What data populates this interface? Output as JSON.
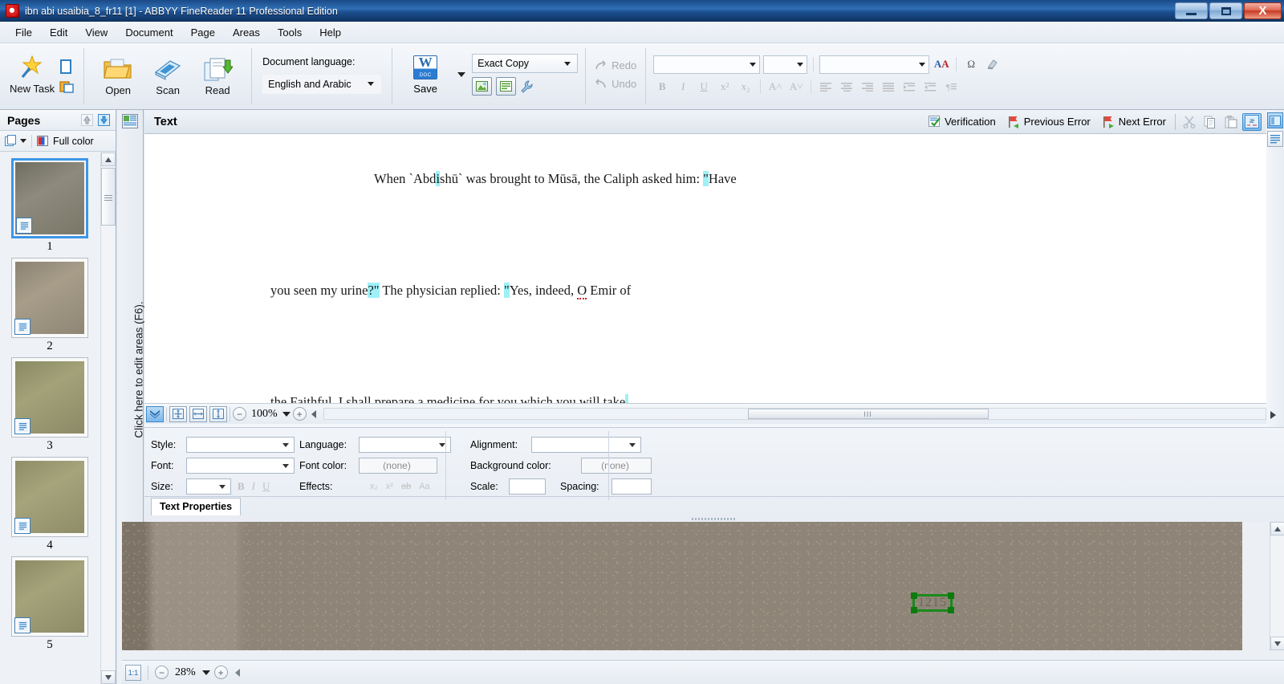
{
  "window": {
    "title": "ibn abi usaibia_8_fr11 [1] - ABBYY FineReader 11 Professional Edition",
    "minimize_label": "Minimize",
    "maximize_label": "Restore",
    "close_label": "X"
  },
  "menu": {
    "items": [
      "File",
      "Edit",
      "View",
      "Document",
      "Page",
      "Areas",
      "Tools",
      "Help"
    ]
  },
  "toolbar": {
    "new_task": "New Task",
    "open": "Open",
    "scan": "Scan",
    "read": "Read",
    "document_language_label": "Document language:",
    "document_language_value": "English and Arabic",
    "save": "Save",
    "save_mode_value": "Exact Copy",
    "redo": "Redo",
    "undo": "Undo",
    "font_name_value": "",
    "font_size_value": "",
    "style_value": "",
    "format_buttons": [
      "B",
      "I",
      "U",
      "x²",
      "x₂",
      "A˄",
      "A˅"
    ],
    "align_buttons": [
      "align-left",
      "align-center",
      "align-right",
      "align-justify",
      "indent",
      "outdent",
      "paragraph"
    ]
  },
  "pages_panel": {
    "title": "Pages",
    "color_mode": "Full color",
    "thumbnails": [
      {
        "number": "1",
        "selected": true
      },
      {
        "number": "2",
        "selected": false
      },
      {
        "number": "3",
        "selected": false
      },
      {
        "number": "4",
        "selected": false
      },
      {
        "number": "5",
        "selected": false
      }
    ]
  },
  "areas_strip": {
    "hint": "Click here to edit areas (F6)."
  },
  "text_panel": {
    "title": "Text",
    "verification": "Verification",
    "previous_error": "Previous Error",
    "next_error": "Next Error",
    "cut": "Cut",
    "copy": "Copy",
    "paste": "Paste",
    "nonprinting": "æ",
    "pilcrow": "¶",
    "lines": [
      {
        "indent": 286,
        "segments": [
          {
            "text": "When `Abd",
            "style": "plain"
          },
          {
            "text": "i",
            "style": "highlight"
          },
          {
            "text": "shū` was brought to Mūsā, the Caliph asked him: ",
            "style": "plain"
          },
          {
            "text": "\"",
            "style": "highlight"
          },
          {
            "text": "Have",
            "style": "plain"
          }
        ]
      },
      {
        "indent": 157,
        "segments": [
          {
            "text": "you seen my urine",
            "style": "plain"
          },
          {
            "text": "?\"",
            "style": "highlight"
          },
          {
            "text": " The physician replied: ",
            "style": "plain"
          },
          {
            "text": "\"",
            "style": "highlight"
          },
          {
            "text": "Yes, indeed, ",
            "style": "plain"
          },
          {
            "text": "O",
            "style": "spell"
          },
          {
            "text": " Emir of",
            "style": "plain"
          }
        ]
      },
      {
        "indent": 157,
        "segments": [
          {
            "text": "the Faithful. I shall prepare a medicine for you which you will take",
            "style": "plain"
          },
          {
            "text": ",",
            "style": "highlight"
          }
        ]
      }
    ]
  },
  "text_zoom_bar": {
    "zoom_value": "100%",
    "fit_buttons": [
      "fit-page",
      "fit-width",
      "fit-height"
    ],
    "zoom_out": "−",
    "zoom_in": "+",
    "scroll_grip": "III"
  },
  "text_properties": {
    "tab_label": "Text Properties",
    "style_label": "Style:",
    "style_value": "",
    "font_label": "Font:",
    "font_value": "",
    "size_label": "Size:",
    "size_value": "",
    "language_label": "Language:",
    "language_value": "",
    "font_color_label": "Font color:",
    "font_color_value": "(none)",
    "effects_label": "Effects:",
    "alignment_label": "Alignment:",
    "alignment_value": "",
    "background_color_label": "Background color:",
    "background_color_value": "(none)",
    "scale_label": "Scale:",
    "scale_value": "",
    "spacing_label": "Spacing:",
    "spacing_value": "",
    "bold": "B",
    "italic": "I",
    "underline": "U",
    "effect_buttons": [
      "x₂",
      "x²",
      "ab",
      "Aa"
    ]
  },
  "image_viewer": {
    "detected_text": "1215",
    "zoom_value": "28%",
    "fit_button": "1:1",
    "zoom_out": "−",
    "zoom_in": "+"
  },
  "colors": {
    "accent": "#3c96e6",
    "highlight": "#9ff0f7",
    "selection_box": "#1a8a1a",
    "spell_error": "#cc2222",
    "titlebar": "#1c4f90"
  }
}
